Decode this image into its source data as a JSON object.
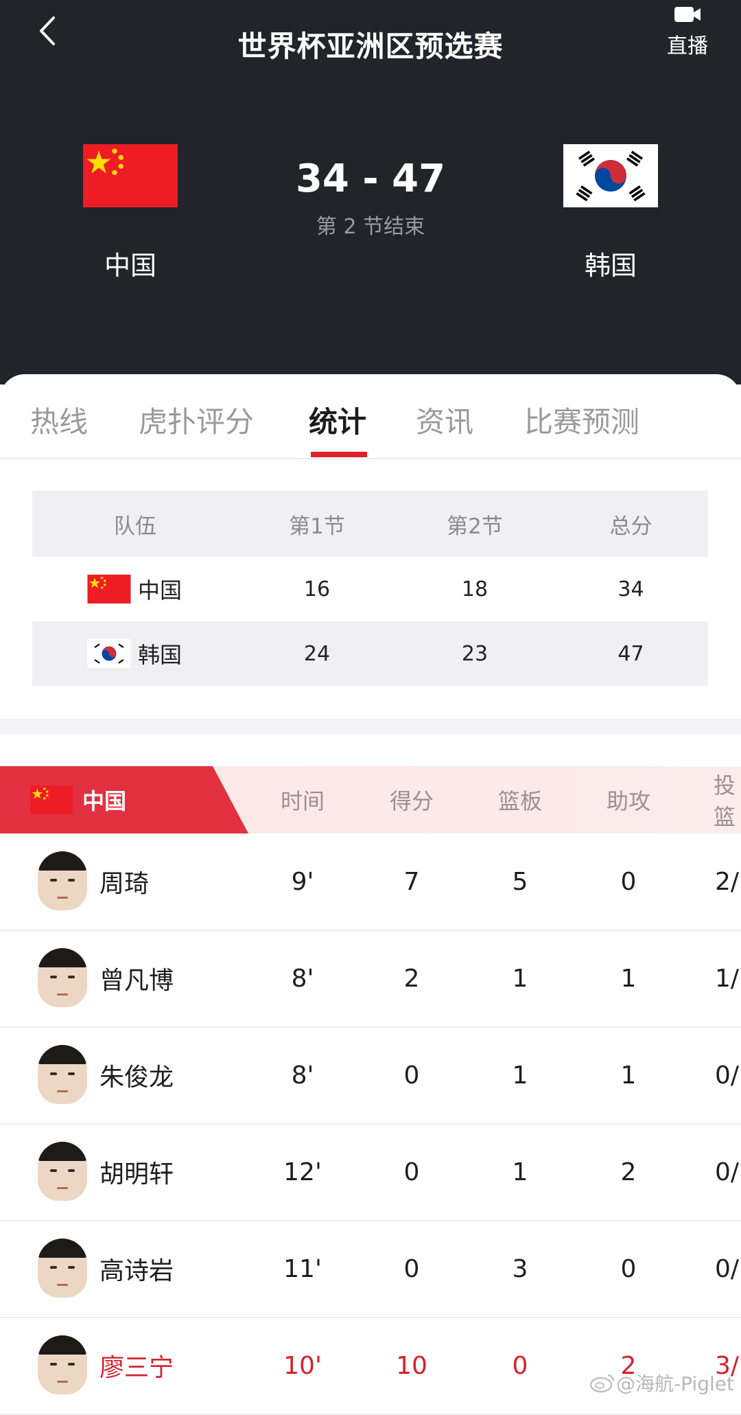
{
  "header": {
    "title": "世界杯亚洲区预选赛",
    "live_label": "直播",
    "home": {
      "name": "中国"
    },
    "away": {
      "name": "韩国"
    },
    "score": "34 - 47",
    "period": "第 2 节结束"
  },
  "tabs": [
    {
      "label": "热线",
      "active": false
    },
    {
      "label": "虎扑评分",
      "active": false
    },
    {
      "label": "统计",
      "active": true
    },
    {
      "label": "资讯",
      "active": false
    },
    {
      "label": "比赛预测",
      "active": false
    }
  ],
  "quarter_table": {
    "headers": [
      "队伍",
      "第1节",
      "第2节",
      "总分"
    ],
    "rows": [
      {
        "team": "中国",
        "q1": "16",
        "q2": "18",
        "total": "34"
      },
      {
        "team": "韩国",
        "q1": "24",
        "q2": "23",
        "total": "47"
      }
    ]
  },
  "player_stats": {
    "team": "中国",
    "columns": [
      "时间",
      "得分",
      "篮板",
      "助攻",
      "投篮"
    ],
    "players": [
      {
        "name": "周琦",
        "time": "9'",
        "pts": "7",
        "reb": "5",
        "ast": "0",
        "fg": "2/"
      },
      {
        "name": "曾凡博",
        "time": "8'",
        "pts": "2",
        "reb": "1",
        "ast": "1",
        "fg": "1/"
      },
      {
        "name": "朱俊龙",
        "time": "8'",
        "pts": "0",
        "reb": "1",
        "ast": "1",
        "fg": "0/"
      },
      {
        "name": "胡明轩",
        "time": "12'",
        "pts": "0",
        "reb": "1",
        "ast": "2",
        "fg": "0/"
      },
      {
        "name": "高诗岩",
        "time": "11'",
        "pts": "0",
        "reb": "3",
        "ast": "0",
        "fg": "0/"
      },
      {
        "name": "廖三宁",
        "time": "10'",
        "pts": "10",
        "reb": "0",
        "ast": "2",
        "fg": "3/"
      }
    ]
  },
  "watermark": "@海航-Piglet",
  "colors": {
    "accent": "#e0202b",
    "header_bg": "#232429",
    "highlight_text": "#d81f2c"
  },
  "icons": {
    "back": "chevron-left-icon",
    "live": "video-camera-icon",
    "watermark": "weibo-icon"
  }
}
